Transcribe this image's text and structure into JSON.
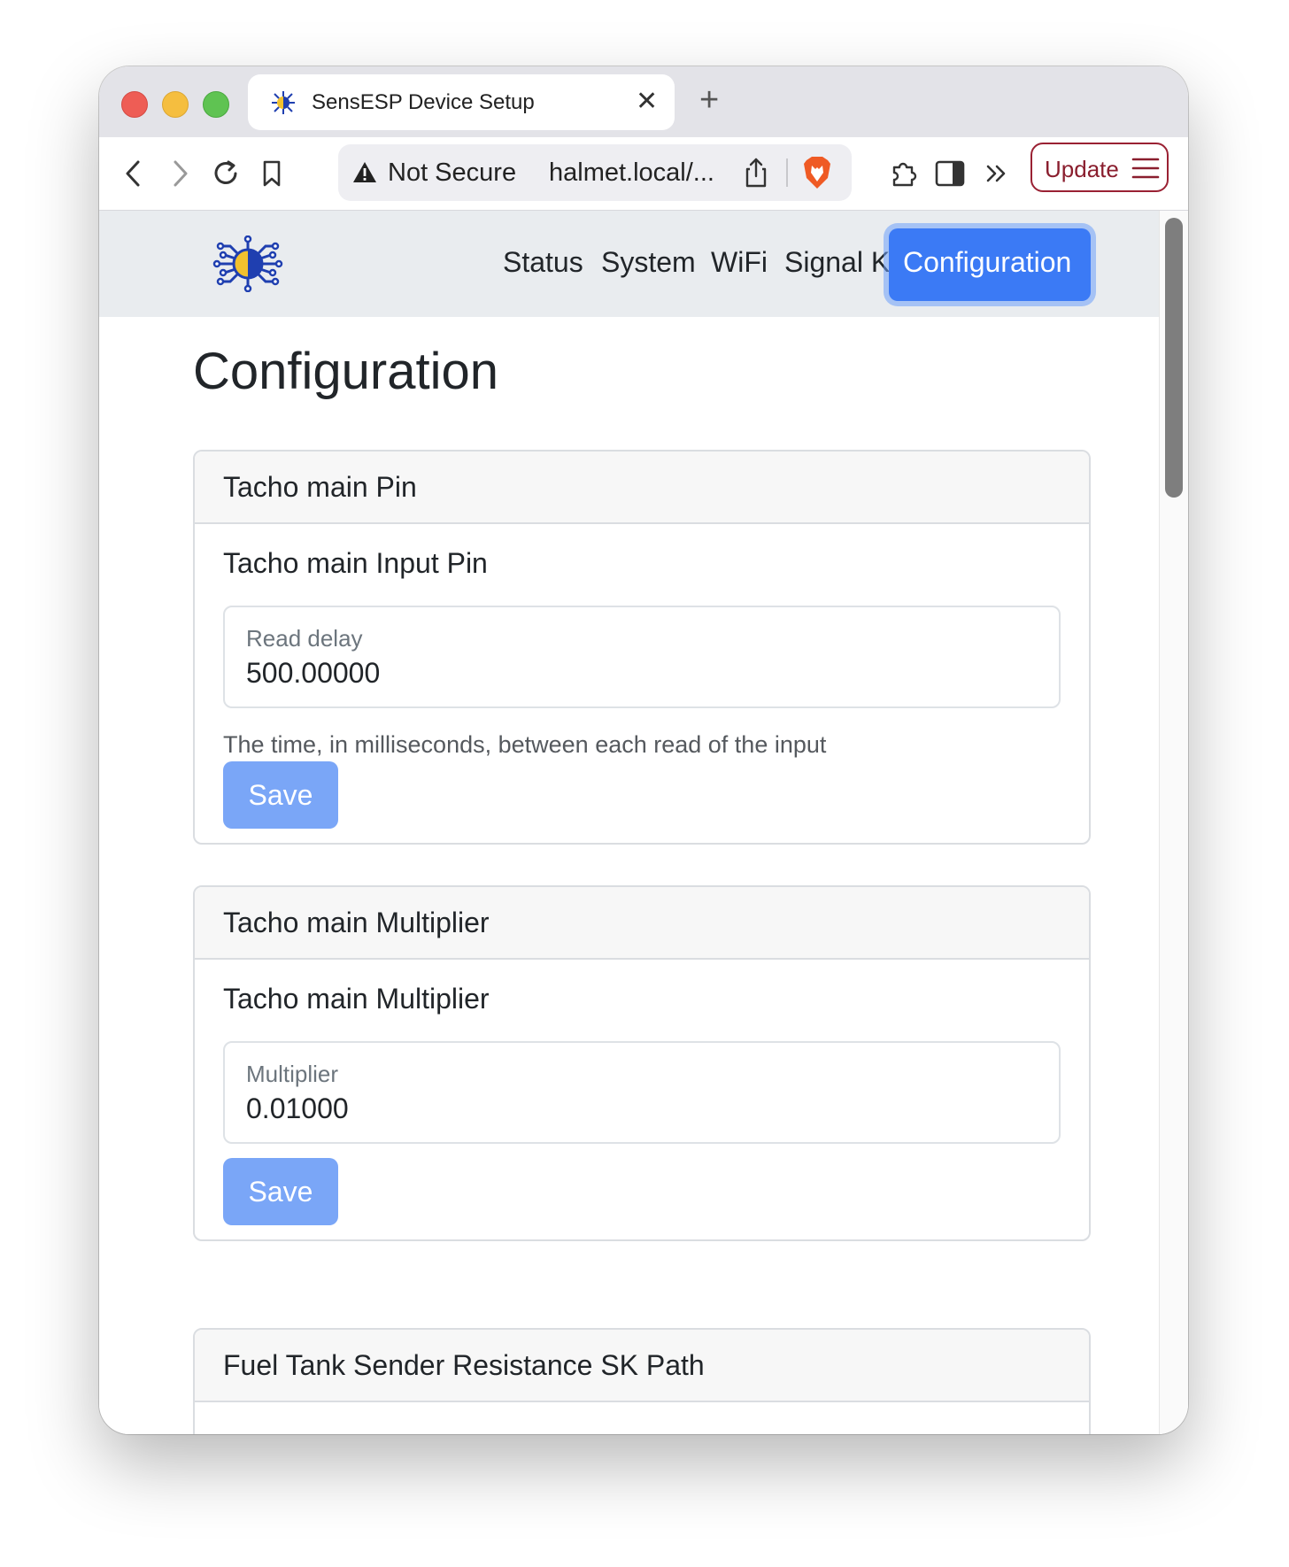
{
  "browser": {
    "tab_title": "SensESP Device Setup",
    "tab_close": "✕",
    "new_tab": "+",
    "security_label": "Not Secure",
    "url": "halmet.local/...",
    "update_label": "Update"
  },
  "nav": {
    "items": [
      {
        "label": "Status"
      },
      {
        "label": "System"
      },
      {
        "label": "WiFi"
      },
      {
        "label": "Signal K"
      }
    ],
    "active_label": "Configuration",
    "active_color": "#3b7af5"
  },
  "page": {
    "title": "Configuration"
  },
  "cards": [
    {
      "header": "Tacho main Pin",
      "subtitle": "Tacho main Input Pin",
      "field_label": "Read delay",
      "field_value": "500.00000",
      "help": "The time, in milliseconds, between each read of the input",
      "save_label": "Save"
    },
    {
      "header": "Tacho main Multiplier",
      "subtitle": "Tacho main Multiplier",
      "field_label": "Multiplier",
      "field_value": "0.01000",
      "save_label": "Save"
    },
    {
      "header": "Fuel Tank Sender Resistance SK Path"
    }
  ],
  "icons": {
    "back": "chevron-left-icon",
    "forward": "chevron-right-icon",
    "reload": "reload-icon",
    "bookmark": "bookmark-icon",
    "warning": "warning-triangle-icon",
    "share": "share-icon",
    "brave": "brave-shield-icon",
    "extensions": "puzzle-piece-icon",
    "sidebar": "sidebar-icon",
    "more": "double-chevron-icon",
    "menu": "hamburger-menu-icon",
    "logo": "sensesp-logo-icon"
  }
}
